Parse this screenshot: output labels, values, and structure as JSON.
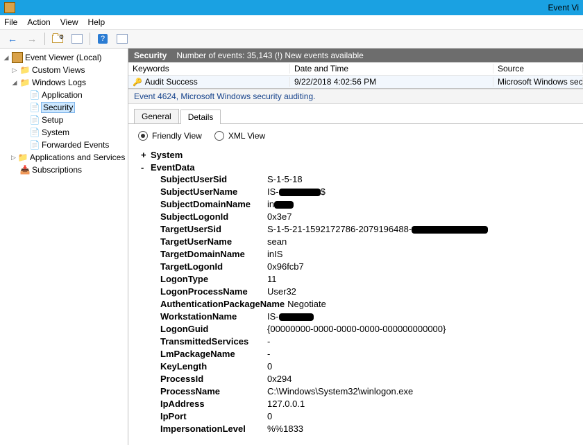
{
  "title": "Event Vi",
  "menu": [
    "File",
    "Action",
    "View",
    "Help"
  ],
  "tree": {
    "root": "Event Viewer (Local)",
    "custom": "Custom Views",
    "winlogs": "Windows Logs",
    "logs": [
      "Application",
      "Security",
      "Setup",
      "System",
      "Forwarded Events"
    ],
    "apps": "Applications and Services Lo",
    "subs": "Subscriptions"
  },
  "status": {
    "heading": "Security",
    "summary": "Number of events: 35,143 (!) New events available"
  },
  "grid": {
    "headers": {
      "keywords": "Keywords",
      "date": "Date and Time",
      "source": "Source"
    },
    "rows": [
      {
        "keywords": "Audit Success",
        "date": "9/22/2018 4:02:56 PM",
        "source": "Microsoft Windows security audit"
      }
    ]
  },
  "eventTitle": "Event 4624, Microsoft Windows security auditing.",
  "tabs": {
    "general": "General",
    "details": "Details"
  },
  "view": {
    "friendly": "Friendly View",
    "xml": "XML View"
  },
  "detail": {
    "system": "System",
    "eventdata": "EventData",
    "fields": [
      {
        "k": "SubjectUserSid",
        "v": "S-1-5-18"
      },
      {
        "k": "SubjectUserName",
        "v": "IS-██████$",
        "redact": 60
      },
      {
        "k": "SubjectDomainName",
        "v": "in███",
        "redact": 28
      },
      {
        "k": "SubjectLogonId",
        "v": "0x3e7"
      },
      {
        "k": "TargetUserSid",
        "v": "S-1-5-21-1592172786-2079196488-████████████",
        "redact": 110
      },
      {
        "k": "TargetUserName",
        "v": "sean"
      },
      {
        "k": "TargetDomainName",
        "v": "inIS"
      },
      {
        "k": "TargetLogonId",
        "v": "0x96fcb7"
      },
      {
        "k": "LogonType",
        "v": "11"
      },
      {
        "k": "LogonProcessName",
        "v": "User32"
      },
      {
        "k": "AuthenticationPackageName",
        "v": "Negotiate"
      },
      {
        "k": "WorkstationName",
        "v": "IS-█████",
        "redact": 50
      },
      {
        "k": "LogonGuid",
        "v": "{00000000-0000-0000-0000-000000000000}"
      },
      {
        "k": "TransmittedServices",
        "v": "-"
      },
      {
        "k": "LmPackageName",
        "v": "-"
      },
      {
        "k": "KeyLength",
        "v": "0"
      },
      {
        "k": "ProcessId",
        "v": "0x294"
      },
      {
        "k": "ProcessName",
        "v": "C:\\Windows\\System32\\winlogon.exe"
      },
      {
        "k": "IpAddress",
        "v": "127.0.0.1"
      },
      {
        "k": "IpPort",
        "v": "0"
      },
      {
        "k": "ImpersonationLevel",
        "v": "%%1833"
      }
    ]
  }
}
